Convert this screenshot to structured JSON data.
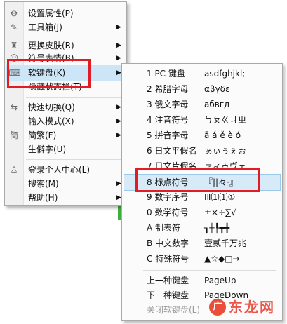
{
  "main_menu": {
    "items": [
      {
        "icon": "gear-icon",
        "glyph": "⚙",
        "label": "设置属性(P)",
        "arrow": ""
      },
      {
        "icon": "wrench-icon",
        "glyph": "✎",
        "label": "工具箱(J)",
        "arrow": "▶"
      },
      {
        "icon": "shirt-icon",
        "glyph": "♜",
        "label": "更换皮肤(R)",
        "arrow": "▶"
      },
      {
        "icon": "smiley-icon",
        "glyph": "☺",
        "label": "符号表情(B)",
        "arrow": "▶"
      },
      {
        "icon": "keyboard-icon",
        "glyph": "⌨",
        "label": "软键盘(K)",
        "arrow": "▶"
      },
      {
        "icon": "",
        "glyph": "",
        "label": "隐藏状态栏(T)",
        "arrow": ""
      },
      {
        "icon": "switch-arrows-icon",
        "glyph": "⇆",
        "label": "快速切换(Q)",
        "arrow": "▶"
      },
      {
        "icon": "",
        "glyph": "",
        "label": "输入模式(X)",
        "arrow": "▶"
      },
      {
        "icon": "simplified-traditional-icon",
        "glyph": "简",
        "label": "简繁(F)",
        "arrow": "▶"
      },
      {
        "icon": "",
        "glyph": "",
        "label": "生僻字(U)",
        "arrow": ""
      },
      {
        "icon": "user-icon",
        "glyph": "♙",
        "label": "登录个人中心(L)",
        "arrow": ""
      },
      {
        "icon": "",
        "glyph": "",
        "label": "搜索(M)",
        "arrow": "▶"
      },
      {
        "icon": "",
        "glyph": "",
        "label": "帮助(H)",
        "arrow": "▶"
      }
    ]
  },
  "soft_keyboard_menu": {
    "items": [
      {
        "label": "1 PC 键盘",
        "chars": "asdfghjkl;"
      },
      {
        "label": "2 希腊字母",
        "chars": "αβγδε"
      },
      {
        "label": "3 俄文字母",
        "chars": "абвгд"
      },
      {
        "label": "4 注音符号",
        "chars": "ㄅㄆㄍㄐㄓ"
      },
      {
        "label": "5 拼音字母",
        "chars": "ā á ě è ó"
      },
      {
        "label": "6 日文平假名",
        "chars": "ぁぃぅぇぉ"
      },
      {
        "label": "7 日文片假名",
        "chars": "ァィゥヴェ"
      },
      {
        "label": "8 标点符号",
        "chars": "『||々·』"
      },
      {
        "label": "9 数字序号",
        "chars": "ⅠⅡ⑴⑴①"
      },
      {
        "label": "0 数学符号",
        "chars": "±×÷∑√"
      },
      {
        "label": "A 制表符",
        "chars": "┒┼┞┳╋"
      },
      {
        "label": "B 中文数字",
        "chars": "壹贰千万兆"
      },
      {
        "label": "C 特殊符号",
        "chars": "▲☆◆□→"
      },
      {
        "label": "上一种键盘",
        "chars": "PageUp"
      },
      {
        "label": "下一种键盘",
        "chars": "PageDown"
      },
      {
        "label": "关闭软键盘(L)",
        "chars": ""
      }
    ]
  },
  "watermark": {
    "logo_glyph": "广",
    "text": "东龙网"
  },
  "colors": {
    "highlight": "#cde6f7",
    "annotation_red": "#e01c24"
  }
}
